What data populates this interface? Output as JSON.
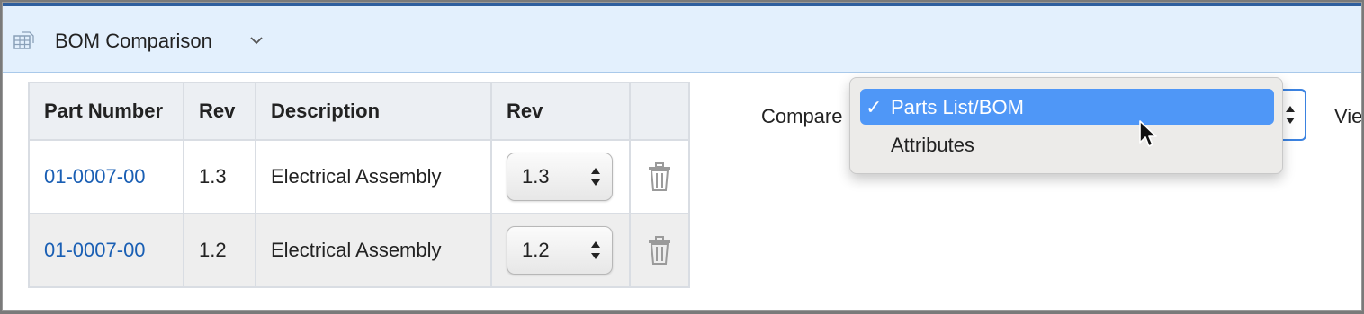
{
  "header": {
    "title": "BOM Comparison",
    "icon": "table-icon",
    "dropdown_icon": "chevron-down-icon"
  },
  "table": {
    "columns": [
      "Part Number",
      "Rev",
      "Description",
      "Rev",
      ""
    ],
    "rows": [
      {
        "part_number": "01-0007-00",
        "rev": "1.3",
        "description": "Electrical Assembly",
        "selected_rev": "1.3"
      },
      {
        "part_number": "01-0007-00",
        "rev": "1.2",
        "description": "Electrical Assembly",
        "selected_rev": "1.2"
      }
    ]
  },
  "compare": {
    "label": "Compare",
    "options": [
      "Parts List/BOM",
      "Attributes"
    ],
    "selected": "Parts List/BOM",
    "check_mark": "✓"
  },
  "view": {
    "label": "Vie"
  },
  "colors": {
    "link": "#1a5fb4",
    "header_bg": "#e3f0fd",
    "selection": "#4f97f7"
  }
}
